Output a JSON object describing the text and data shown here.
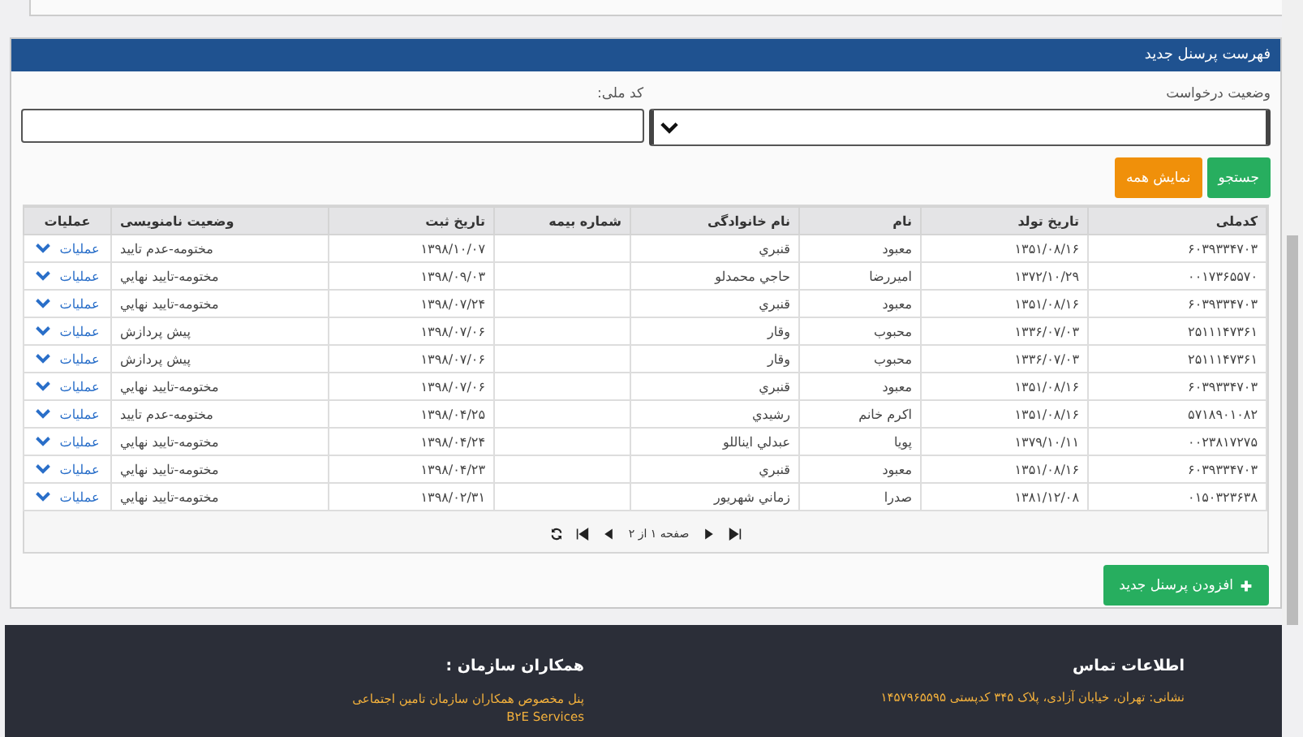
{
  "panel": {
    "title": "فهرست پرسنل جدید"
  },
  "form": {
    "status_label": "وضعیت درخواست",
    "national_code_label": "کد ملی:"
  },
  "buttons": [
    {
      "label": "جستجو",
      "kind": "success"
    },
    {
      "label": "نمایش همه",
      "kind": "warning"
    }
  ],
  "table": {
    "columns": [
      "کدملی",
      "تاریخ تولد",
      "نام",
      "نام خانوادگی",
      "شماره بیمه",
      "تاریخ ثبت",
      "وضعیت نامنویسی",
      "عملیات"
    ],
    "rows": [
      {
        "national_code": "۶۰۳۹۳۳۴۷۰۳",
        "birth_date": "۱۳۵۱/۰۸/۱۶",
        "first_name": "معبود",
        "last_name": "قنبري",
        "reg_date": "۱۳۹۸/۱۰/۰۷",
        "status": "مختومه-عدم تاييد",
        "action": "عمليات"
      },
      {
        "national_code": "۰۰۱۷۳۶۵۵۷۰",
        "birth_date": "۱۳۷۲/۱۰/۲۹",
        "first_name": "اميررضا",
        "last_name": "حاجي محمدلو",
        "reg_date": "۱۳۹۸/۰۹/۰۳",
        "status": "مختومه-تاييد نهايي",
        "action": "عمليات"
      },
      {
        "national_code": "۶۰۳۹۳۳۴۷۰۳",
        "birth_date": "۱۳۵۱/۰۸/۱۶",
        "first_name": "معبود",
        "last_name": "قنبري",
        "reg_date": "۱۳۹۸/۰۷/۲۴",
        "status": "مختومه-تاييد نهايي",
        "action": "عمليات"
      },
      {
        "national_code": "۲۵۱۱۱۴۷۳۶۱",
        "birth_date": "۱۳۳۶/۰۷/۰۳",
        "first_name": "محبوب",
        "last_name": "وقار",
        "reg_date": "۱۳۹۸/۰۷/۰۶",
        "status": "پيش پردازش",
        "action": "عمليات"
      },
      {
        "national_code": "۲۵۱۱۱۴۷۳۶۱",
        "birth_date": "۱۳۳۶/۰۷/۰۳",
        "first_name": "محبوب",
        "last_name": "وقار",
        "reg_date": "۱۳۹۸/۰۷/۰۶",
        "status": "پيش پردازش",
        "action": "عمليات"
      },
      {
        "national_code": "۶۰۳۹۳۳۴۷۰۳",
        "birth_date": "۱۳۵۱/۰۸/۱۶",
        "first_name": "معبود",
        "last_name": "قنبري",
        "reg_date": "۱۳۹۸/۰۷/۰۶",
        "status": "مختومه-تاييد نهايي",
        "action": "عمليات"
      },
      {
        "national_code": "۵۷۱۸۹۰۱۰۸۲",
        "birth_date": "۱۳۵۱/۰۸/۱۶",
        "first_name": "اكرم خانم",
        "last_name": "رشيدي",
        "reg_date": "۱۳۹۸/۰۴/۲۵",
        "status": "مختومه-عدم تاييد",
        "action": "عمليات"
      },
      {
        "national_code": "۰۰۲۳۸۱۷۲۷۵",
        "birth_date": "۱۳۷۹/۱۰/۱۱",
        "first_name": "پويا",
        "last_name": "عبدلي ايناللو",
        "reg_date": "۱۳۹۸/۰۴/۲۴",
        "status": "مختومه-تاييد نهايي",
        "action": "عمليات"
      },
      {
        "national_code": "۶۰۳۹۳۳۴۷۰۳",
        "birth_date": "۱۳۵۱/۰۸/۱۶",
        "first_name": "معبود",
        "last_name": "قنبري",
        "reg_date": "۱۳۹۸/۰۴/۲۳",
        "status": "مختومه-تاييد نهايي",
        "action": "عمليات"
      },
      {
        "national_code": "۰۱۵۰۳۲۳۶۳۸",
        "birth_date": "۱۳۸۱/۱۲/۰۸",
        "first_name": "صدرا",
        "last_name": "زماني شهريور",
        "reg_date": "۱۳۹۸/۰۲/۳۱",
        "status": "مختومه-تاييد نهايي",
        "action": "عمليات"
      }
    ]
  },
  "pager": {
    "text": "صفحه ۱ از ۲"
  },
  "add_button": {
    "label": "افزودن پرسنل جدید"
  },
  "footer": {
    "contact": {
      "title": "اطلاعات تماس",
      "address": "نشانی: تهران، خیابان آزادی، پلاک ۳۴۵ کدپستی ۱۴۵۷۹۶۵۵۹۵"
    },
    "partners": {
      "title": "همکاران سازمان :",
      "lines": [
        "پنل مخصوص همکاران سازمان تامین اجتماعی",
        "B۲E Services"
      ]
    }
  }
}
